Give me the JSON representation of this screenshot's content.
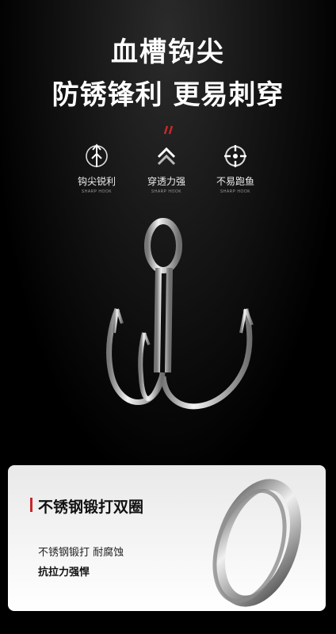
{
  "headline": {
    "line1": "血槽钩尖",
    "line2": "防锈锋利  更易刺穿"
  },
  "features": [
    {
      "icon": "arrow-spear-icon",
      "label": "钩尖锐利",
      "sub": "SHARP HOOK"
    },
    {
      "icon": "chevron-up-icon",
      "label": "穿透力强",
      "sub": "SHARP HOOK"
    },
    {
      "icon": "crosshair-icon",
      "label": "不易跑鱼",
      "sub": "SHARP HOOK"
    }
  ],
  "card": {
    "title": "不锈钢锻打双圈",
    "line1": "不锈钢锻打 耐腐蚀",
    "line2": "抗拉力强悍"
  },
  "colors": {
    "accent": "#c62828",
    "background": "#000000",
    "card": "#f2f2f2"
  }
}
